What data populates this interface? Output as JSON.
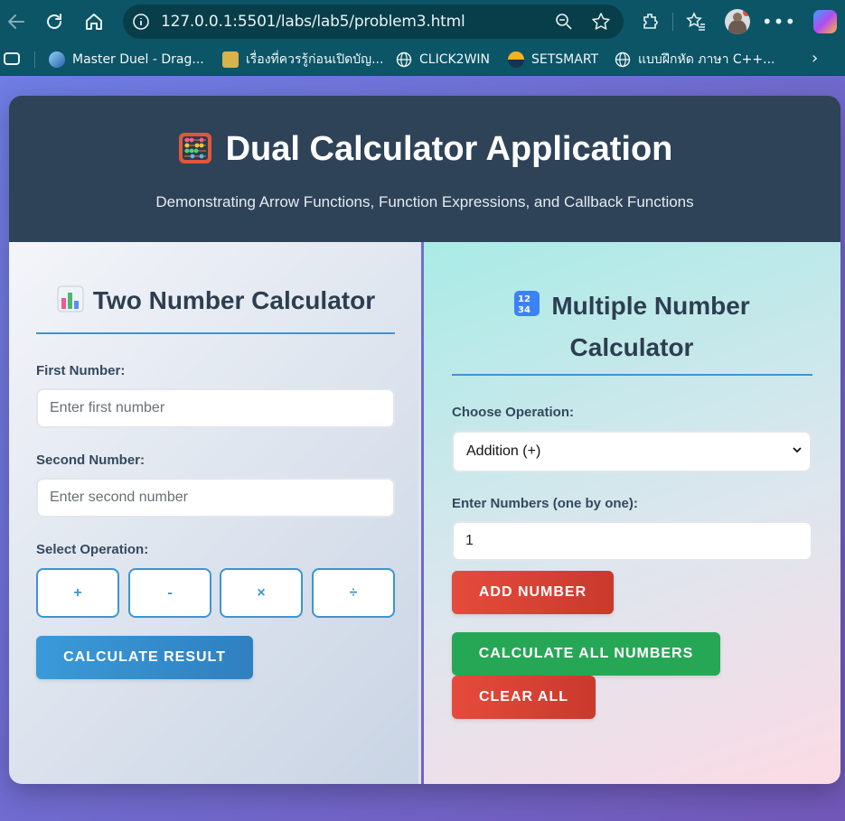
{
  "browser": {
    "url": "127.0.0.1:5501/labs/lab5/problem3.html",
    "bookmarks": [
      {
        "label": "Master Duel - Drag..."
      },
      {
        "label": "เรื่องที่ควรรู้ก่อนเปิดบัญ..."
      },
      {
        "label": "CLICK2WIN"
      },
      {
        "label": "SETSMART"
      },
      {
        "label": "แบบฝึกหัด ภาษา C++..."
      }
    ]
  },
  "header": {
    "title": "Dual Calculator Application",
    "subtitle": "Demonstrating Arrow Functions, Function Expressions, and Callback Functions"
  },
  "left": {
    "title": "Two Number Calculator",
    "first_label": "First Number:",
    "first_placeholder": "Enter first number",
    "second_label": "Second Number:",
    "second_placeholder": "Enter second number",
    "op_label": "Select Operation:",
    "ops": [
      "+",
      "-",
      "×",
      "÷"
    ],
    "calc_button": "CALCULATE RESULT"
  },
  "right": {
    "title_line1": "Multiple Number",
    "title_line2": "Calculator",
    "op_label": "Choose Operation:",
    "selected_op": "Addition (+)",
    "numbers_label": "Enter Numbers (one by one):",
    "number_value": "1",
    "add_button": "ADD NUMBER",
    "calc_all_button": "CALCULATE ALL NUMBERS",
    "clear_button": "CLEAR ALL"
  },
  "colors": {
    "header_bg": "#2e4358",
    "accent_blue": "#3d95cf",
    "red": "#e54b3c",
    "green": "#26a755"
  }
}
